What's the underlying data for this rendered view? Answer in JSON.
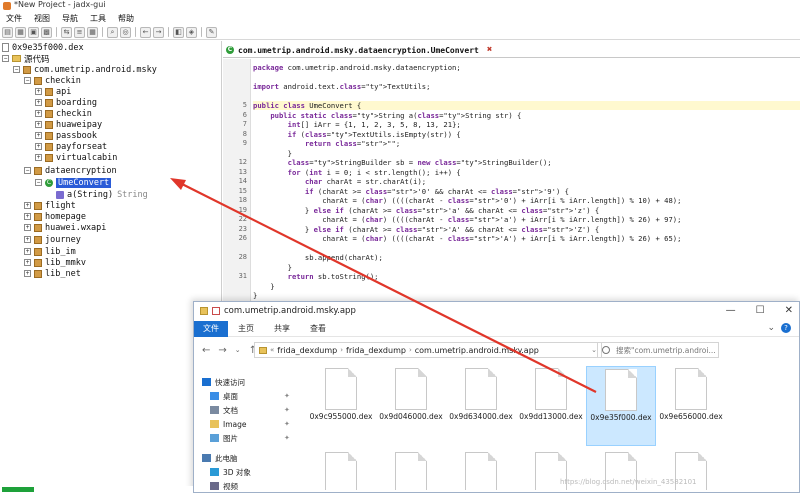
{
  "window": {
    "title": "*New Project - jadx-gui"
  },
  "menu": [
    "文件",
    "视图",
    "导航",
    "工具",
    "帮助"
  ],
  "tree": {
    "root": "0x9e35f000.dex",
    "source_label": "源代码",
    "package_root": "com.umetrip.android.msky",
    "checkin": {
      "label": "checkin",
      "children": [
        "api",
        "boarding",
        "checkin",
        "huaweipay",
        "passbook",
        "payforseat",
        "virtualcabin"
      ]
    },
    "dataencryption": {
      "label": "dataencryption",
      "class_name": "UmeConvert",
      "method": "a(String)",
      "method_return": "String"
    },
    "others": [
      "flight",
      "homepage",
      "huawei.wxapi",
      "journey",
      "lib_im",
      "lib_mmkv",
      "lib_net"
    ]
  },
  "editor": {
    "tab_label": "com.umetrip.android.msky.dataencryption.UmeConvert",
    "lines": [
      {
        "n": "",
        "t": "package com.umetrip.android.msky.dataencryption;"
      },
      {
        "n": "",
        "t": ""
      },
      {
        "n": "",
        "t": "import android.text.TextUtils;"
      },
      {
        "n": "",
        "t": ""
      },
      {
        "n": "5",
        "t": "public class UmeConvert {"
      },
      {
        "n": "6",
        "t": "    public static String a(String str) {"
      },
      {
        "n": "7",
        "t": "        int[] iArr = {1, 1, 2, 3, 5, 8, 13, 21};"
      },
      {
        "n": "8",
        "t": "        if (TextUtils.isEmpty(str)) {"
      },
      {
        "n": "9",
        "t": "            return \"\";"
      },
      {
        "n": "",
        "t": "        }"
      },
      {
        "n": "12",
        "t": "        StringBuilder sb = new StringBuilder();"
      },
      {
        "n": "13",
        "t": "        for (int i = 0; i < str.length(); i++) {"
      },
      {
        "n": "14",
        "t": "            char charAt = str.charAt(i);"
      },
      {
        "n": "15",
        "t": "            if (charAt >= '0' && charAt <= '9') {"
      },
      {
        "n": "18",
        "t": "                charAt = (char) ((((charAt - '0') + iArr[i % iArr.length]) % 10) + 48);"
      },
      {
        "n": "19",
        "t": "            } else if (charAt >= 'a' && charAt <= 'z') {"
      },
      {
        "n": "22",
        "t": "                charAt = (char) ((((charAt - 'a') + iArr[i % iArr.length]) % 26) + 97);"
      },
      {
        "n": "23",
        "t": "            } else if (charAt >= 'A' && charAt <= 'Z') {"
      },
      {
        "n": "26",
        "t": "                charAt = (char) ((((charAt - 'A') + iArr[i % iArr.length]) % 26) + 65);"
      },
      {
        "n": "",
        "t": ""
      },
      {
        "n": "28",
        "t": "            sb.append(charAt);"
      },
      {
        "n": "",
        "t": "        }"
      },
      {
        "n": "31",
        "t": "        return sb.toString();"
      },
      {
        "n": "",
        "t": "    }"
      },
      {
        "n": "",
        "t": "}"
      }
    ]
  },
  "explorer": {
    "title": "com.umetrip.android.msky.app",
    "ribbon": {
      "file": "文件",
      "home": "主页",
      "share": "共享",
      "view": "查看"
    },
    "path": [
      "frida_dexdump",
      "frida_dexdump",
      "com.umetrip.android.msky.app"
    ],
    "search_placeholder": "搜索\"com.umetrip.androi...",
    "nav": [
      {
        "label": "快速访问",
        "icon": "star-icon",
        "pinned": false
      },
      {
        "label": "桌面",
        "icon": "desktop-icon",
        "pinned": true
      },
      {
        "label": "文档",
        "icon": "documents-icon",
        "pinned": true
      },
      {
        "label": "Image",
        "icon": "image-folder-icon",
        "pinned": true
      },
      {
        "label": "图片",
        "icon": "pictures-icon",
        "pinned": true
      },
      {
        "label": "此电脑",
        "icon": "computer-icon",
        "pinned": false
      },
      {
        "label": "3D 对象",
        "icon": "3d-objects-icon",
        "pinned": false
      },
      {
        "label": "视频",
        "icon": "video-icon",
        "pinned": false
      }
    ],
    "files": [
      "0x9c955000.dex",
      "0x9d046000.dex",
      "0x9d634000.dex",
      "0x9dd13000.dex",
      "0x9e35f000.dex",
      "0x9e656000.dex"
    ],
    "selected_file": "0x9e35f000.dex"
  },
  "colors": {
    "annotation_arrow": "#e0362a",
    "selection": "#2a5bd7",
    "progress": "#1ea13a"
  },
  "watermark": "https://blog.csdn.net/weixin_43582101"
}
